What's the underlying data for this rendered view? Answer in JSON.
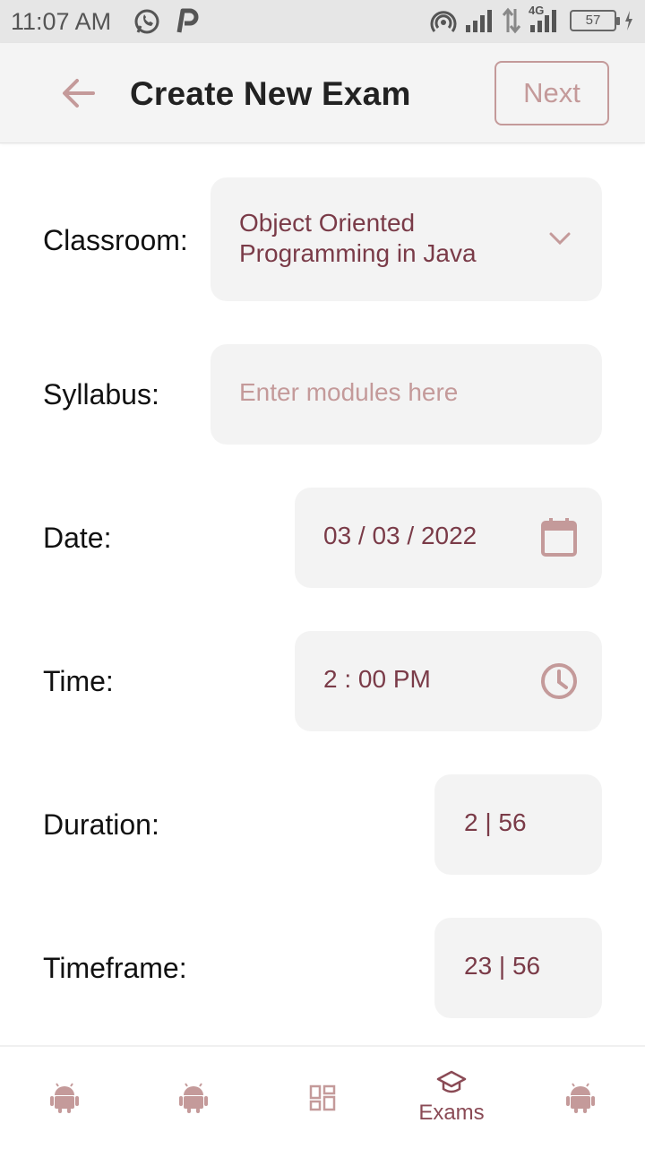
{
  "status_bar": {
    "time": "11:07 AM",
    "battery": "57",
    "network": "4G"
  },
  "header": {
    "title": "Create New Exam",
    "next_label": "Next"
  },
  "form": {
    "classroom": {
      "label": "Classroom:",
      "value_line1": "Object Oriented",
      "value_line2": "Programming in Java"
    },
    "syllabus": {
      "label": "Syllabus:",
      "placeholder": "Enter modules here"
    },
    "date": {
      "label": "Date:",
      "value": "03 / 03 / 2022"
    },
    "time": {
      "label": "Time:",
      "value": "2 : 00 PM"
    },
    "duration": {
      "label": "Duration:",
      "value": "2 | 56"
    },
    "timeframe": {
      "label": "Timeframe:",
      "value": "23 | 56"
    }
  },
  "bottom_nav": {
    "items": [
      {
        "icon": "android-icon",
        "label": ""
      },
      {
        "icon": "android-icon",
        "label": ""
      },
      {
        "icon": "dashboard-icon",
        "label": ""
      },
      {
        "icon": "school-icon",
        "label": "Exams"
      },
      {
        "icon": "android-icon",
        "label": ""
      }
    ]
  },
  "colors": {
    "accent": "#c49a9a",
    "value_text": "#7a3b48",
    "field_bg": "#f3f3f3"
  }
}
